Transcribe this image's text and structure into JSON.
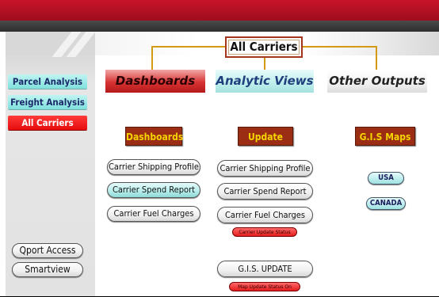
{
  "title": "All Carriers",
  "sidebar": {
    "items": [
      {
        "label": "Parcel Analysis"
      },
      {
        "label": "Freight Analysis"
      },
      {
        "label": "All Carriers"
      }
    ],
    "bottom": [
      {
        "label": "Qport Access"
      },
      {
        "label": "Smartview"
      }
    ]
  },
  "columns": {
    "dashboards": "Dashboards",
    "analytic_views": "Analytic Views",
    "other_outputs": "Other Outputs"
  },
  "sections": {
    "dashboards": "Dashboards",
    "update": "Update",
    "gis_maps": "G.I.S Maps"
  },
  "dashboards_buttons": [
    {
      "label": "Carrier Shipping Profile"
    },
    {
      "label": "Carrier Spend Report"
    },
    {
      "label": "Carrier Fuel Charges"
    }
  ],
  "update_buttons": [
    {
      "label": "Carrier Shipping Profile"
    },
    {
      "label": "Carrier Spend Report"
    },
    {
      "label": "Carrier Fuel Charges"
    }
  ],
  "carrier_update_status": "Carrier Update Status",
  "gis_update": "G.I.S. UPDATE",
  "map_update_status": "Map Update Status On",
  "gis_buttons": [
    {
      "label": "USA"
    },
    {
      "label": "CANADA"
    }
  ],
  "colors": {
    "top_bar": "#c8142a",
    "dark_bar": "#3a3a3a",
    "section_bg": "#9b2d14",
    "section_text": "#f5d400",
    "connector": "#d39a16"
  }
}
